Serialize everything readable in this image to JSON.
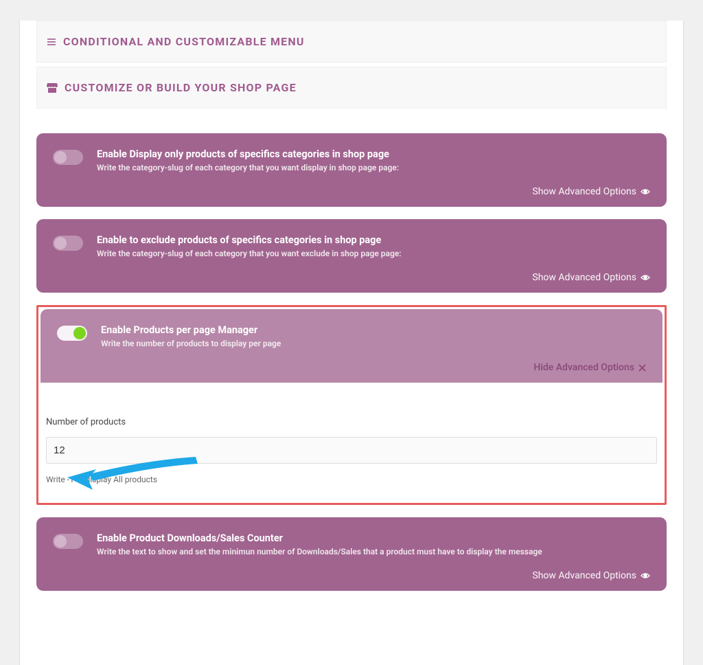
{
  "accordion": [
    {
      "icon": "menu-icon",
      "title": "CONDITIONAL AND CUSTOMIZABLE MENU"
    },
    {
      "icon": "shop-icon",
      "title": "CUSTOMIZE OR BUILD YOUR SHOP PAGE"
    }
  ],
  "panels": {
    "display_only": {
      "title": "Enable Display only products of specifics categories in shop page",
      "subtitle": "Write the category-slug of each category that you want display in shop page page:",
      "footer": "Show Advanced Options",
      "toggle": false
    },
    "exclude": {
      "title": "Enable to exclude products of specifics categories in shop page",
      "subtitle": "Write the category-slug of each category that you want exclude in shop page page:",
      "footer": "Show Advanced Options",
      "toggle": false
    },
    "per_page": {
      "title": "Enable Products per page Manager",
      "subtitle": "Write the number of products to display per page",
      "footer": "Hide Advanced Options",
      "toggle": true,
      "field_label": "Number of products",
      "field_value": "12",
      "field_help": "Write -1 to display All products"
    },
    "downloads": {
      "title": "Enable Product Downloads/Sales Counter",
      "subtitle": "Write the text to show and set the minimun number of Downloads/Sales that a product must have to display the message",
      "footer": "Show Advanced Options",
      "toggle": false
    }
  }
}
